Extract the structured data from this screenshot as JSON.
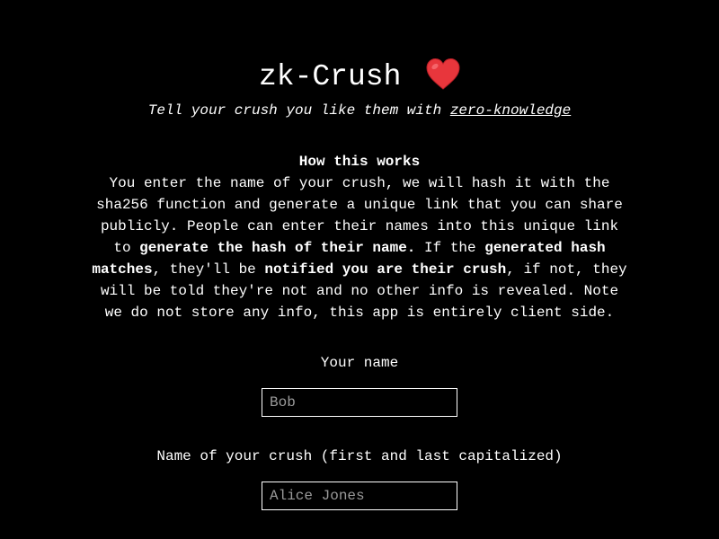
{
  "header": {
    "title": "zk-Crush",
    "title_icon": "red-heart-emoji",
    "subtitle_prefix": "Tell your crush you like them with ",
    "subtitle_link": "zero-knowledge"
  },
  "how": {
    "heading": "How this works",
    "p1": "You enter the name of your crush, we will hash it with the sha256 function and generate a unique link that you can share publicly. People can enter their names into this unique link to ",
    "b1": "generate the hash of their name.",
    "p2": " If the ",
    "b2": "generated hash matches",
    "p3": ", they'll be ",
    "b3": "notified you are their crush",
    "p4": ", if not, they will be told they're not and no other info is revealed. Note we do not store any info, this app is entirely client side."
  },
  "form": {
    "your_name_label": "Your name",
    "your_name_placeholder": "Bob",
    "crush_label": "Name of your crush (first and last capitalized)",
    "crush_placeholder": "Alice Jones"
  },
  "colors": {
    "background": "#000000",
    "text": "#ffffff",
    "heart": "#e8363c",
    "placeholder": "#9a9a9a"
  }
}
